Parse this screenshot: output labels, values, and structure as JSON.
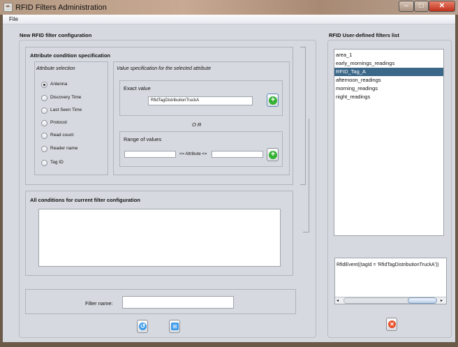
{
  "window": {
    "title": "RFID Filters Administration"
  },
  "menu": {
    "file": "File"
  },
  "left": {
    "title": "New RFID filter configuration",
    "attr_panel_title": "Attribute condition specification",
    "attr_selection_title": "Attribute selection",
    "attributes": [
      {
        "label": "Antenna",
        "selected": true
      },
      {
        "label": "Discovery Time",
        "selected": false
      },
      {
        "label": "Last Seen Time",
        "selected": false
      },
      {
        "label": "Protocol",
        "selected": false
      },
      {
        "label": "Read count",
        "selected": false
      },
      {
        "label": "Reader name",
        "selected": false
      },
      {
        "label": "Tag ID",
        "selected": false
      }
    ],
    "value_spec_title": "Value specification for the selected attribute",
    "exact_title": "Exact value",
    "exact_value": "RfidTagDistributionTruckA",
    "or_label": "O R",
    "range_title": "Range of values",
    "range_min": "",
    "range_max": "",
    "range_between": "<= Attribute <=",
    "conditions_title": "All conditions for current filter configuration",
    "conditions_text": "",
    "filter_name_label": "Filter name:",
    "filter_name_value": ""
  },
  "right": {
    "title": "RFID User-defined filters list",
    "filters": [
      "area_1",
      "early_mornings_readings",
      "RFID_Tag_A",
      "afternoon_readings",
      "morning_readings",
      "night_readings"
    ],
    "selected_index": 2,
    "expression": "RfidEvent((tagId = 'RfidTagDistributionTruckA'))"
  },
  "colors": {
    "selection": "#3b6788",
    "add_green": "#34b233",
    "delete_red": "#e8502a",
    "action_blue": "#3d9be9"
  }
}
